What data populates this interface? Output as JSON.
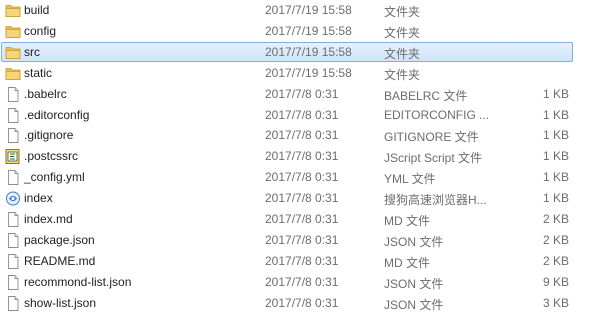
{
  "colors": {
    "selection_fill": "#cfe4fa",
    "selection_border": "#84acdd",
    "folder": "#e8bf4a",
    "secondary_text": "#6d6d6d"
  },
  "files": [
    {
      "name": "build",
      "modified": "2017/7/19 15:58",
      "type": "文件夹",
      "size": "",
      "icon": "folder-icon",
      "selected": false
    },
    {
      "name": "config",
      "modified": "2017/7/19 15:58",
      "type": "文件夹",
      "size": "",
      "icon": "folder-icon",
      "selected": false
    },
    {
      "name": "src",
      "modified": "2017/7/19 15:58",
      "type": "文件夹",
      "size": "",
      "icon": "folder-icon",
      "selected": true
    },
    {
      "name": "static",
      "modified": "2017/7/19 15:58",
      "type": "文件夹",
      "size": "",
      "icon": "folder-icon",
      "selected": false
    },
    {
      "name": ".babelrc",
      "modified": "2017/7/8 0:31",
      "type": "BABELRC 文件",
      "size": "1 KB",
      "icon": "file-icon",
      "selected": false
    },
    {
      "name": ".editorconfig",
      "modified": "2017/7/8 0:31",
      "type": "EDITORCONFIG ...",
      "size": "1 KB",
      "icon": "file-icon",
      "selected": false
    },
    {
      "name": ".gitignore",
      "modified": "2017/7/8 0:31",
      "type": "GITIGNORE 文件",
      "size": "1 KB",
      "icon": "file-icon",
      "selected": false
    },
    {
      "name": ".postcssrc",
      "modified": "2017/7/8 0:31",
      "type": "JScript Script 文件",
      "size": "1 KB",
      "icon": "script-icon",
      "selected": false
    },
    {
      "name": "_config.yml",
      "modified": "2017/7/8 0:31",
      "type": "YML 文件",
      "size": "1 KB",
      "icon": "file-icon",
      "selected": false
    },
    {
      "name": "index",
      "modified": "2017/7/8 0:31",
      "type": "搜狗高速浏览器H...",
      "size": "1 KB",
      "icon": "browser-html-icon",
      "selected": false
    },
    {
      "name": "index.md",
      "modified": "2017/7/8 0:31",
      "type": "MD 文件",
      "size": "2 KB",
      "icon": "file-icon",
      "selected": false
    },
    {
      "name": "package.json",
      "modified": "2017/7/8 0:31",
      "type": "JSON 文件",
      "size": "2 KB",
      "icon": "file-icon",
      "selected": false
    },
    {
      "name": "README.md",
      "modified": "2017/7/8 0:31",
      "type": "MD 文件",
      "size": "2 KB",
      "icon": "file-icon",
      "selected": false
    },
    {
      "name": "recommond-list.json",
      "modified": "2017/7/8 0:31",
      "type": "JSON 文件",
      "size": "9 KB",
      "icon": "file-icon",
      "selected": false
    },
    {
      "name": "show-list.json",
      "modified": "2017/7/8 0:31",
      "type": "JSON 文件",
      "size": "3 KB",
      "icon": "file-icon",
      "selected": false
    }
  ]
}
